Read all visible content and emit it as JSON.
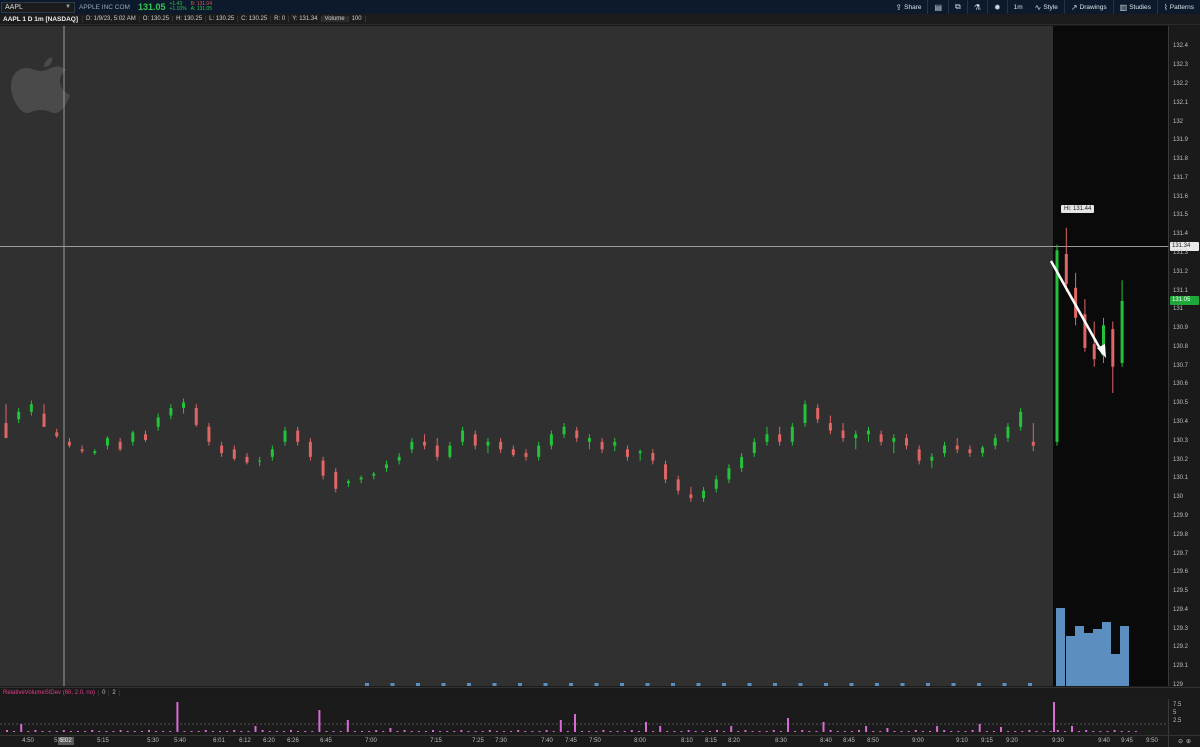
{
  "header": {
    "symbol": "AAPL",
    "company": "APPLE INC COM",
    "last": "131.05",
    "change_abs": "+1.43",
    "change_pct": "+1.10%",
    "bid": "B: 131.04",
    "ask": "A: 131.05",
    "tools": [
      {
        "icon": "share-icon",
        "label": "Share"
      },
      {
        "icon": "chart-layout-icon",
        "label": ""
      },
      {
        "icon": "export-icon",
        "label": ""
      },
      {
        "icon": "flask-icon",
        "label": ""
      },
      {
        "icon": "gear-icon",
        "label": ""
      },
      {
        "icon": "timeframe-icon",
        "label": "1m"
      },
      {
        "icon": "style-icon",
        "label": "Style"
      },
      {
        "icon": "drawings-icon",
        "label": "Drawings"
      },
      {
        "icon": "studies-icon",
        "label": "Studies"
      },
      {
        "icon": "patterns-icon",
        "label": "Patterns"
      }
    ]
  },
  "infobar": {
    "title": "AAPL 1 D 1m [NASDAQ]",
    "date": "D: 1/9/23, 5:02 AM",
    "open": "O: 130.25",
    "high": "H: 130.25",
    "low": "L: 130.25",
    "close": "C: 130.25",
    "range": "R: 0",
    "y": "Y: 131.34",
    "volume_label": "Volume",
    "volume": "100"
  },
  "price_axis": {
    "ticks": [
      "132.4",
      "132.3",
      "132.2",
      "132.1",
      "132",
      "131.9",
      "131.8",
      "131.7",
      "131.6",
      "131.5",
      "131.4",
      "131.3",
      "131.2",
      "131.1",
      "131",
      "130.9",
      "130.8",
      "130.7",
      "130.6",
      "130.5",
      "130.4",
      "130.3",
      "130.2",
      "130.1",
      "130",
      "129.9",
      "129.8",
      "129.7",
      "129.6",
      "129.5",
      "129.4",
      "129.3",
      "129.2",
      "129.1",
      "129"
    ],
    "crosshair_label": "131.34",
    "last_label": "131.05",
    "hi_label": "Hi: 131.44"
  },
  "study": {
    "name": "RelativeVolumeStDev (60, 2.0, no)",
    "p1": "0",
    "p2": "2",
    "ticks": [
      "7.5",
      "5",
      "2.5"
    ]
  },
  "time_axis": {
    "ticks": [
      "4:50",
      "5:05",
      "5:15",
      "5:30",
      "5:40",
      "6:01",
      "6:12",
      "6:20",
      "6:26",
      "6:45",
      "7:00",
      "7:15",
      "7:25",
      "7:30",
      "7:40",
      "7:45",
      "7:50",
      "8:00",
      "8:10",
      "8:15",
      "8:20",
      "8:30",
      "8:40",
      "8:45",
      "8:50",
      "9:00",
      "9:10",
      "9:15",
      "9:20",
      "9:30",
      "9:40",
      "9:45",
      "9:50"
    ],
    "cursor": "5:02"
  },
  "colors": {
    "up": "#22c33a",
    "down": "#e06565",
    "volume": "#5c8fbf",
    "study_bar": "#d96bd6",
    "background": "#303030",
    "after_hours": "#0a0a0a"
  },
  "chart_data": {
    "type": "candlestick",
    "ylim": [
      129,
      132.45
    ],
    "x_range": [
      "4:50",
      "9:50"
    ],
    "annotations": [
      "Hi: 131.44"
    ],
    "candles": [
      [
        130.4,
        130.5,
        130.32,
        130.32
      ],
      [
        130.42,
        130.48,
        130.4,
        130.46
      ],
      [
        130.46,
        130.52,
        130.44,
        130.5
      ],
      [
        130.45,
        130.5,
        130.38,
        130.38
      ],
      [
        130.35,
        130.37,
        130.32,
        130.33
      ],
      [
        130.3,
        130.32,
        130.27,
        130.28
      ],
      [
        130.26,
        130.28,
        130.24,
        130.25
      ],
      [
        130.24,
        130.26,
        130.23,
        130.25
      ],
      [
        130.28,
        130.33,
        130.26,
        130.32
      ],
      [
        130.3,
        130.32,
        130.25,
        130.26
      ],
      [
        130.3,
        130.36,
        130.28,
        130.35
      ],
      [
        130.34,
        130.36,
        130.3,
        130.31
      ],
      [
        130.38,
        130.45,
        130.36,
        130.43
      ],
      [
        130.44,
        130.5,
        130.42,
        130.48
      ],
      [
        130.48,
        130.53,
        130.45,
        130.51
      ],
      [
        130.48,
        130.5,
        130.38,
        130.39
      ],
      [
        130.38,
        130.4,
        130.28,
        130.3
      ],
      [
        130.28,
        130.3,
        130.22,
        130.24
      ],
      [
        130.26,
        130.28,
        130.2,
        130.21
      ],
      [
        130.22,
        130.24,
        130.18,
        130.19
      ],
      [
        130.2,
        130.22,
        130.17,
        130.2
      ],
      [
        130.22,
        130.28,
        130.2,
        130.26
      ],
      [
        130.3,
        130.38,
        130.28,
        130.36
      ],
      [
        130.36,
        130.38,
        130.28,
        130.3
      ],
      [
        130.3,
        130.32,
        130.2,
        130.22
      ],
      [
        130.2,
        130.22,
        130.1,
        130.12
      ],
      [
        130.14,
        130.16,
        130.03,
        130.05
      ],
      [
        130.08,
        130.1,
        130.06,
        130.09
      ],
      [
        130.1,
        130.12,
        130.08,
        130.11
      ],
      [
        130.12,
        130.14,
        130.1,
        130.13
      ],
      [
        130.16,
        130.2,
        130.14,
        130.18
      ],
      [
        130.2,
        130.24,
        130.18,
        130.22
      ],
      [
        130.26,
        130.32,
        130.24,
        130.3
      ],
      [
        130.3,
        130.34,
        130.26,
        130.28
      ],
      [
        130.28,
        130.32,
        130.2,
        130.22
      ],
      [
        130.22,
        130.3,
        130.21,
        130.28
      ],
      [
        130.3,
        130.38,
        130.28,
        130.36
      ],
      [
        130.34,
        130.36,
        130.26,
        130.28
      ],
      [
        130.28,
        130.32,
        130.24,
        130.3
      ],
      [
        130.3,
        130.32,
        130.24,
        130.26
      ],
      [
        130.26,
        130.28,
        130.22,
        130.23
      ],
      [
        130.24,
        130.26,
        130.2,
        130.22
      ],
      [
        130.22,
        130.3,
        130.2,
        130.28
      ],
      [
        130.28,
        130.36,
        130.26,
        130.34
      ],
      [
        130.34,
        130.4,
        130.32,
        130.38
      ],
      [
        130.36,
        130.38,
        130.3,
        130.32
      ],
      [
        130.3,
        130.34,
        130.26,
        130.32
      ],
      [
        130.3,
        130.32,
        130.24,
        130.26
      ],
      [
        130.28,
        130.32,
        130.25,
        130.3
      ],
      [
        130.26,
        130.28,
        130.2,
        130.22
      ],
      [
        130.24,
        130.26,
        130.2,
        130.25
      ],
      [
        130.24,
        130.26,
        130.18,
        130.2
      ],
      [
        130.18,
        130.2,
        130.08,
        130.1
      ],
      [
        130.1,
        130.12,
        130.02,
        130.04
      ],
      [
        130.02,
        130.06,
        129.98,
        130.0
      ],
      [
        130.0,
        130.06,
        129.98,
        130.04
      ],
      [
        130.05,
        130.12,
        130.03,
        130.1
      ],
      [
        130.1,
        130.18,
        130.08,
        130.16
      ],
      [
        130.16,
        130.24,
        130.14,
        130.22
      ],
      [
        130.24,
        130.32,
        130.22,
        130.3
      ],
      [
        130.3,
        130.38,
        130.28,
        130.34
      ],
      [
        130.34,
        130.38,
        130.28,
        130.3
      ],
      [
        130.3,
        130.4,
        130.28,
        130.38
      ],
      [
        130.4,
        130.52,
        130.38,
        130.5
      ],
      [
        130.48,
        130.5,
        130.4,
        130.42
      ],
      [
        130.4,
        130.44,
        130.34,
        130.36
      ],
      [
        130.36,
        130.4,
        130.3,
        130.32
      ],
      [
        130.32,
        130.36,
        130.26,
        130.34
      ],
      [
        130.34,
        130.38,
        130.3,
        130.36
      ],
      [
        130.34,
        130.36,
        130.28,
        130.3
      ],
      [
        130.3,
        130.34,
        130.24,
        130.32
      ],
      [
        130.32,
        130.34,
        130.26,
        130.28
      ],
      [
        130.26,
        130.28,
        130.18,
        130.2
      ],
      [
        130.2,
        130.24,
        130.16,
        130.22
      ],
      [
        130.24,
        130.3,
        130.22,
        130.28
      ],
      [
        130.28,
        130.32,
        130.24,
        130.26
      ],
      [
        130.26,
        130.28,
        130.22,
        130.24
      ],
      [
        130.24,
        130.28,
        130.22,
        130.27
      ],
      [
        130.28,
        130.34,
        130.26,
        130.32
      ],
      [
        130.32,
        130.4,
        130.3,
        130.38
      ],
      [
        130.38,
        130.48,
        130.36,
        130.46
      ],
      [
        130.3,
        130.4,
        130.25,
        130.28
      ],
      [
        130.3,
        131.35,
        130.28,
        131.32
      ],
      [
        131.3,
        131.44,
        131.1,
        131.14
      ],
      [
        131.12,
        131.2,
        130.92,
        130.96
      ],
      [
        130.98,
        131.06,
        130.78,
        130.8
      ],
      [
        130.82,
        130.94,
        130.7,
        130.74
      ],
      [
        130.76,
        130.96,
        130.72,
        130.92
      ],
      [
        130.9,
        130.94,
        130.56,
        130.7
      ],
      [
        130.72,
        131.16,
        130.7,
        131.05
      ]
    ],
    "volume_note": "Premarket volume small; regular session 9:30 volume spikes to ~129.4 level on price scale"
  }
}
